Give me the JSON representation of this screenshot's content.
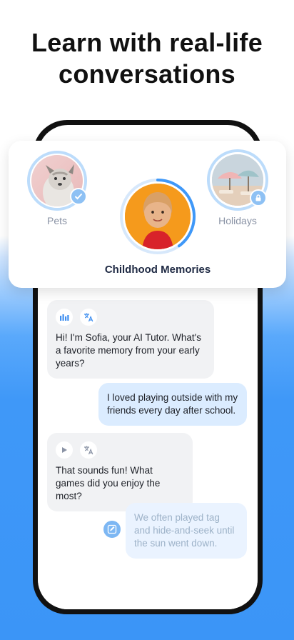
{
  "headline": {
    "line1": "Learn with real-life",
    "line2": "conversations"
  },
  "topics": {
    "pets": {
      "label": "Pets",
      "status_icon": "check-icon"
    },
    "childhood_memories": {
      "label": "Childhood Memories",
      "progress": 0.4
    },
    "holidays": {
      "label": "Holidays",
      "status_icon": "lock-icon"
    }
  },
  "chat": {
    "messages": [
      {
        "role": "ai",
        "text": "Hi! I'm Sofia, your AI Tutor. What's a favorite memory from your early years?",
        "icons": [
          "audio-bars-icon",
          "translate-icon"
        ]
      },
      {
        "role": "user",
        "text": "I loved playing outside with my friends every day after school."
      },
      {
        "role": "ai",
        "text": "That sounds fun! What games did you enjoy the most?",
        "icons": [
          "play-icon",
          "translate-icon"
        ]
      },
      {
        "role": "user",
        "text": "We often played tag and hide-and-seek until the sun went down.",
        "icons": [
          "correction-icon"
        ]
      }
    ]
  },
  "colors": {
    "accent": "#3f98f8",
    "ring": "#bcdcfb",
    "user_bubble": "#dbecff",
    "ai_bubble": "#f1f2f4"
  }
}
